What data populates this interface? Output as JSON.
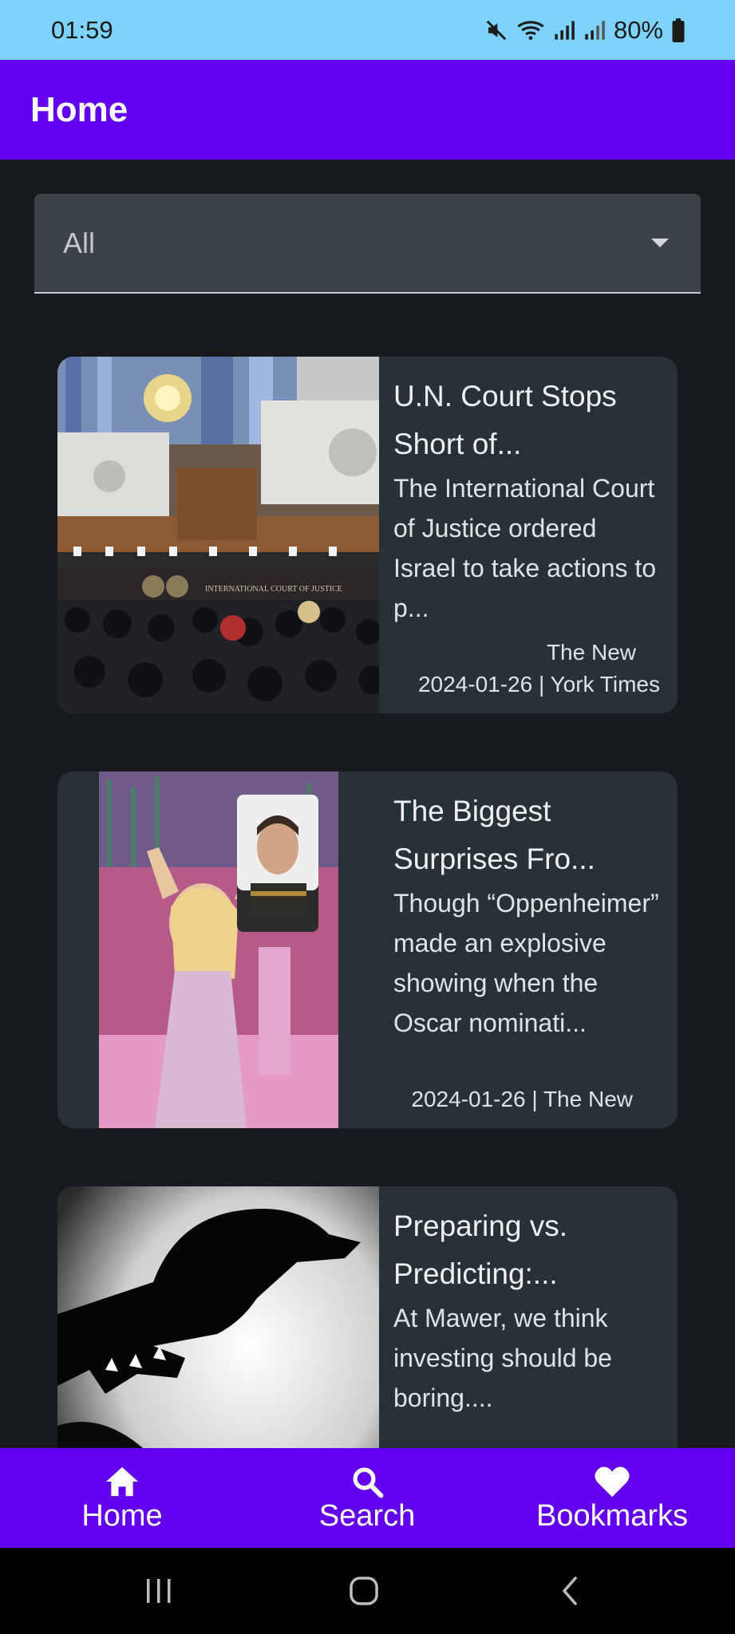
{
  "status_bar": {
    "time": "01:59",
    "battery": "80%"
  },
  "app_bar": {
    "title": "Home"
  },
  "filter": {
    "selected": "All"
  },
  "articles": [
    {
      "title": "U.N. Court Stops Short of...",
      "description": "The International Court of Justice ordered Israel to take actions to p...",
      "date": "2024-01-26",
      "source_line1": "The New",
      "source_line2": "York Times",
      "image_label": "INTERNATIONAL COURT OF JUSTICE"
    },
    {
      "title": "The Biggest Surprises Fro...",
      "description": "Though “Oppenheimer” made an explosive showing when the Oscar nominati...",
      "date": "2024-01-26",
      "source": "The New"
    },
    {
      "title": "Preparing vs. Predicting:...",
      "description": "At Mawer, we think investing should be boring...."
    }
  ],
  "bottom_nav": {
    "items": [
      {
        "label": "Home",
        "icon": "home-icon"
      },
      {
        "label": "Search",
        "icon": "search-icon"
      },
      {
        "label": "Bookmarks",
        "icon": "heart-icon"
      }
    ]
  },
  "colors": {
    "primary": "#6200ee",
    "status_bar": "#7dd3fc",
    "card": "#263238",
    "background": "#181b1e"
  }
}
